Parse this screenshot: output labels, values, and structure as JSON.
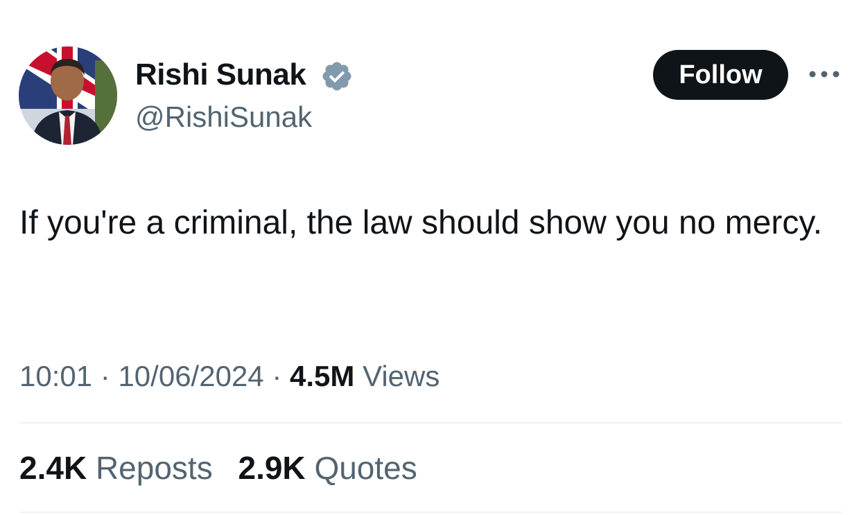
{
  "author": {
    "display_name": "Rishi Sunak",
    "handle": "@RishiSunak",
    "verified_icon": "verified-badge-icon",
    "verified_color": "#829aab"
  },
  "actions": {
    "follow_label": "Follow",
    "more_icon": "more-horizontal-icon"
  },
  "tweet": {
    "text": "If you're a criminal, the law should show you no mercy."
  },
  "meta": {
    "time": "10:01",
    "separator": "·",
    "date": "10/06/2024",
    "views_count": "4.5M",
    "views_label": "Views"
  },
  "stats": {
    "reposts_count": "2.4K",
    "reposts_label": "Reposts",
    "quotes_count": "2.9K",
    "quotes_label": "Quotes"
  },
  "colors": {
    "text_primary": "#0f1419",
    "text_secondary": "#536471",
    "follow_bg": "#0f1419",
    "divider": "#eff3f4"
  }
}
